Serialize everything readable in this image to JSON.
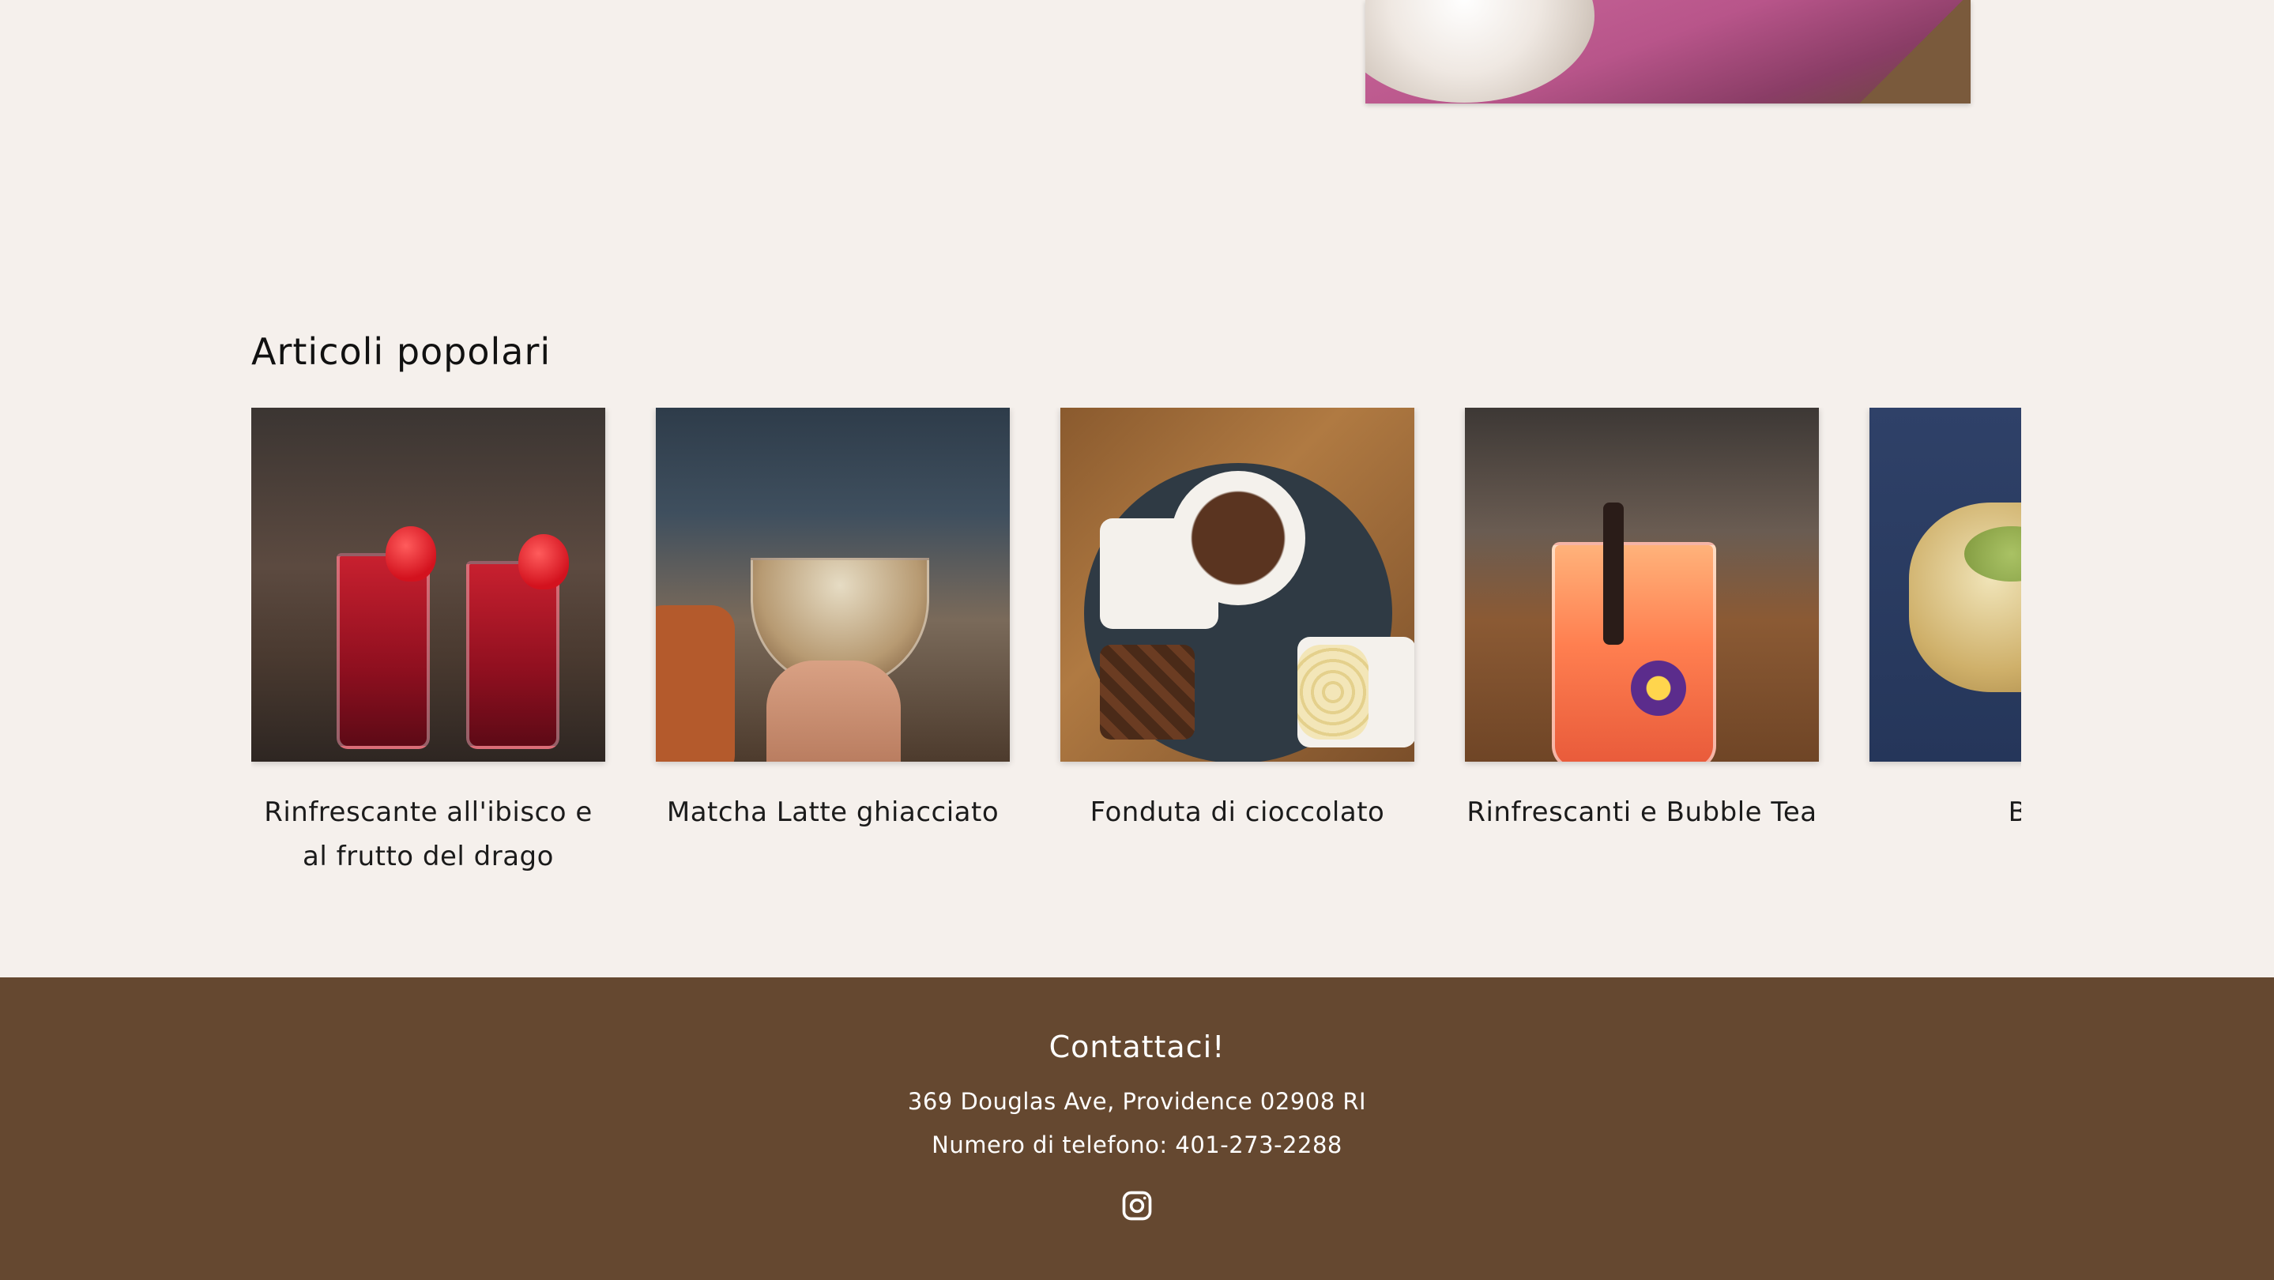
{
  "popular": {
    "title": "Articoli popolari",
    "items": [
      {
        "title": "Rinfrescante all'ibisco e al frutto del drago"
      },
      {
        "title": "Matcha Latte ghiacciato"
      },
      {
        "title": "Fonduta di cioccolato"
      },
      {
        "title": "Rinfrescanti e Bubble Tea"
      },
      {
        "title": "Bakla"
      }
    ]
  },
  "footer": {
    "heading": "Contattaci!",
    "address": "369 Douglas Ave, Providence 02908 RI",
    "phone": "Numero di telefono: 401-273-2288",
    "social_icon": "instagram-icon"
  },
  "colors": {
    "page_bg": "#f5f0ec",
    "footer_bg": "#654830",
    "footer_text": "#ffffff"
  }
}
